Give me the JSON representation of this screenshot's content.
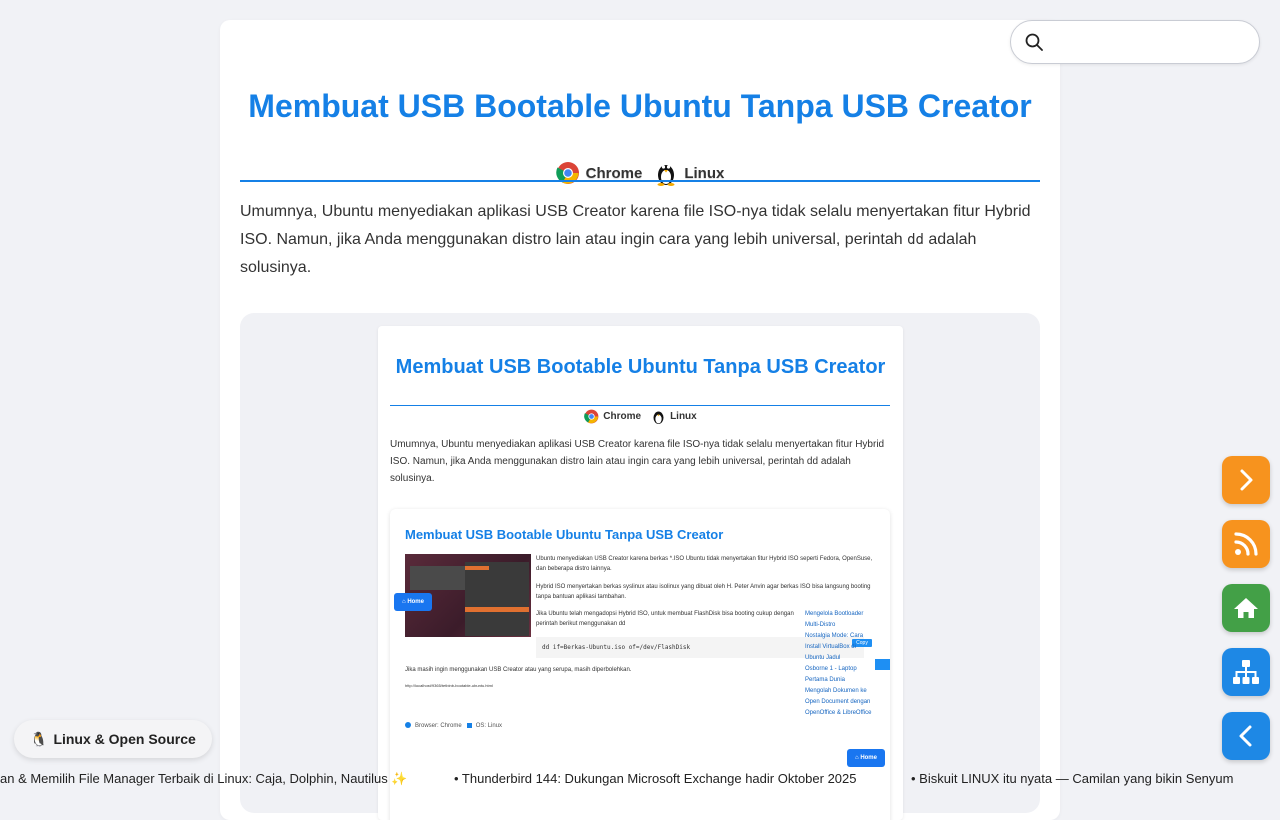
{
  "article": {
    "title": "Membuat USB Bootable Ubuntu Tanpa USB Creator",
    "tags": [
      "Chrome",
      "Linux"
    ],
    "intro_before": "Umumnya, Ubuntu menyediakan aplikasi USB Creator karena file ISO-nya tidak selalu menyertakan fitur Hybrid ISO. Namun, jika Anda menggunakan distro lain atau ingin cara yang lebih universal, perintah ",
    "intro_code": "dd",
    "intro_after": " adalah solusinya."
  },
  "screenshot": {
    "title": "Membuat USB Bootable Ubuntu Tanpa USB Creator",
    "tags": [
      "Chrome",
      "Linux"
    ],
    "intro": "Umumnya, Ubuntu menyediakan aplikasi USB Creator karena file ISO-nya tidak selalu menyertakan fitur Hybrid ISO. Namun, jika Anda menggunakan distro lain atau ingin cara yang lebih universal, perintah dd adalah solusinya.",
    "nested": {
      "title": "Membuat USB Bootable Ubuntu Tanpa USB Creator",
      "p1": "Ubuntu menyediakan USB Creator karena berkas *.ISO Ubuntu tidak menyertakan fitur Hybrid ISO seperti Fedora, OpenSuse, dan beberapa distro lainnya.",
      "p2": "Hybrid ISO menyertakan berkas syslinux atau isolinux yang dibuat oleh H. Peter Anvin agar berkas ISO bisa langsung booting tanpa bantuan aplikasi tambahan.",
      "p3": "Jika Ubuntu telah mengadopsi Hybrid ISO, untuk membuat FlashDisk bisa booting cukup dengan perintah berikut menggunakan dd",
      "code": "dd if=Berkas-Ubuntu.iso of=/dev/FlashDisk",
      "copy": "Copy",
      "p4": "Jika masih ingin menggunakan USB Creator atau yang serupa, masih diperbolehkan.",
      "url": "http://localhost/9365/tetbinb-bootable-ubuntu.html",
      "home": "Home",
      "sidebar": [
        "Mengelola Bootloader",
        "Multi-Distro",
        "Nostalgia Mode: Cara",
        "Install VirtualBox di",
        "Ubuntu Jadul",
        "Osborne 1 - Laptop",
        "Pertama Dunia",
        "Mengolah Dokumen ke",
        "Open Document dengan",
        "OpenOffice & LibreOffice"
      ],
      "footer_browser": "Browser: Chrome",
      "footer_os": "OS: Linux"
    }
  },
  "search": {
    "placeholder": "",
    "icon": "search-icon"
  },
  "fabs": [
    "next-icon",
    "rss-icon",
    "home-icon",
    "sitemap-icon",
    "back-icon"
  ],
  "badge": {
    "label": "Linux & Open Source",
    "icon": "penguin-icon"
  },
  "ticker": [
    "an & Memilih File Manager Terbaik di Linux: Caja, Dolphin, Nautilus ✨",
    "• Thunderbird 144: Dukungan Microsoft Exchange hadir Oktober 2025",
    "• Biskuit LINUX itu nyata — Camilan yang bikin Senyum"
  ],
  "colors": {
    "accent": "#1580e6",
    "orange": "#f7931e",
    "green": "#43a047",
    "blue": "#1e88e5"
  }
}
